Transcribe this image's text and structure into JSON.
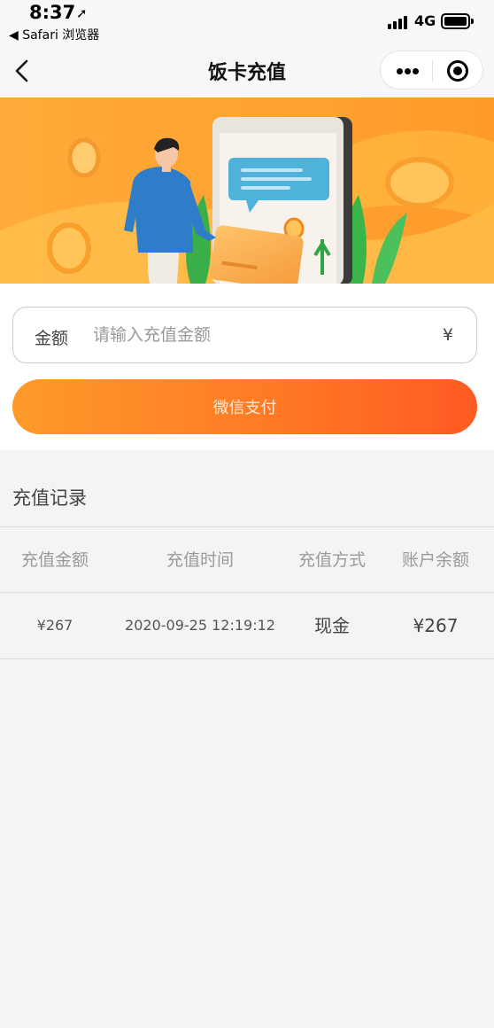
{
  "status_bar": {
    "time": "8:37",
    "back_app": "◀ Safari 浏览器",
    "network": "4G"
  },
  "nav": {
    "title": "饭卡充值"
  },
  "form": {
    "amount_label": "金额",
    "amount_placeholder": "请输入充值金额",
    "currency_symbol": "¥",
    "pay_button": "微信支付"
  },
  "records": {
    "title": "充值记录",
    "columns": [
      "充值金额",
      "充值时间",
      "充值方式",
      "账户余额"
    ],
    "rows": [
      {
        "amount": "¥267",
        "time": "2020-09-25 12:19:12",
        "method": "现金",
        "balance": "¥267"
      }
    ]
  },
  "colors": {
    "accent": "#ff7a26",
    "banner": "#ffa936",
    "page_bg": "#f4f4f4"
  }
}
